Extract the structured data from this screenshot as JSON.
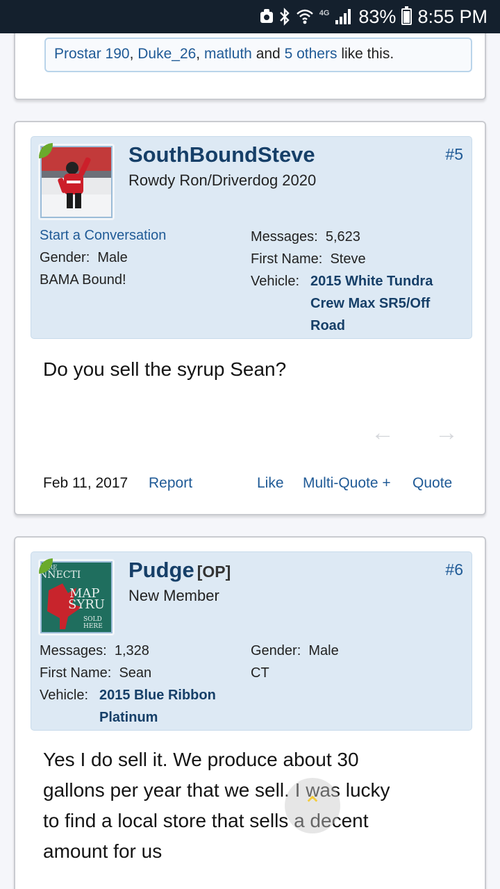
{
  "status_bar": {
    "net_label": "4G",
    "battery": "83%",
    "battery_level": 0.83,
    "time": "8:55 PM"
  },
  "likes": {
    "users": [
      "Prostar 190",
      "Duke_26",
      "matluth"
    ],
    "conj": "and",
    "others": "5 others",
    "suffix": "like this."
  },
  "posts": [
    {
      "username": "SouthBoundSteve",
      "user_title": "Rowdy Ron/Driverdog 2020",
      "post_number": "#5",
      "start_conversation": "Start a Conversation",
      "gender_label": "Gender:",
      "gender": "Male",
      "extra": "BAMA Bound!",
      "messages_label": "Messages:",
      "messages": "5,623",
      "first_name_label": "First Name:",
      "first_name": "Steve",
      "vehicle_label": "Vehicle:",
      "vehicle_lines": [
        "2015 White Tundra",
        "Crew Max SR5/Off",
        "Road"
      ],
      "text": "Do you sell the syrup Sean?",
      "date": "Feb 11, 2017",
      "report": "Report",
      "like": "Like",
      "multi_quote": "Multi-Quote +",
      "quote": "Quote"
    },
    {
      "username": "Pudge",
      "op_tag": "[OP]",
      "user_title": "New Member",
      "post_number": "#6",
      "messages_label": "Messages:",
      "messages": "1,328",
      "first_name_label": "First Name:",
      "first_name": "Sean",
      "vehicle_label": "Vehicle:",
      "vehicle_lines": [
        "2015 Blue Ribbon",
        "Platinum"
      ],
      "gender_label": "Gender:",
      "gender": "Male",
      "location": "CT",
      "avatar_text": [
        "ORE",
        "NNECTI",
        "MAP",
        "SYRU",
        "SOLD",
        "HERE"
      ],
      "text_lines": [
        "Yes I do sell it. We produce about 30",
        "gallons per year that we sell. I was lucky",
        "to find a local store that sells a decent",
        "amount for us"
      ]
    }
  ]
}
